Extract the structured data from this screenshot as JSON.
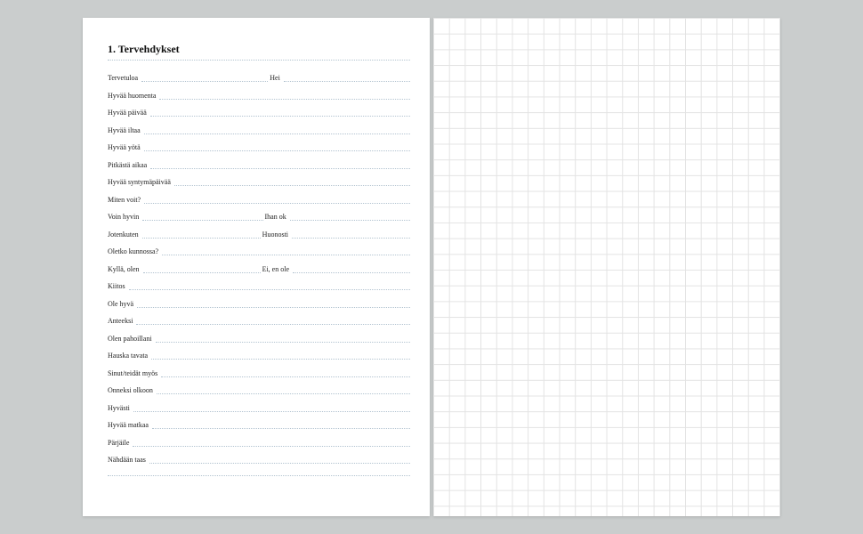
{
  "title": "1. Tervehdykset",
  "rows": [
    {
      "left": "Tervetuloa",
      "right": "Hei"
    },
    {
      "left": "Hyvää huomenta"
    },
    {
      "left": "Hyvää päivää"
    },
    {
      "left": "Hyvää iltaa"
    },
    {
      "left": "Hyvää yötä"
    },
    {
      "left": "Pitkästä aikaa"
    },
    {
      "left": "Hyvää syntymäpäivää"
    },
    {
      "left": "Miten voit?"
    },
    {
      "left": "Voin hyvin",
      "right": "Ihan ok"
    },
    {
      "left": "Jotenkuten",
      "right": "Huonosti"
    },
    {
      "left": "Oletko kunnossa?"
    },
    {
      "left": "Kyllä, olen",
      "right": "Ei, en ole"
    },
    {
      "left": "Kiitos"
    },
    {
      "left": "Ole hyvä"
    },
    {
      "left": "Anteeksi"
    },
    {
      "left": "Olen pahoillani"
    },
    {
      "left": "Hauska tavata"
    },
    {
      "left": "Sinut/teidät myös"
    },
    {
      "left": "Onneksi olkoon"
    },
    {
      "left": "Hyvästi"
    },
    {
      "left": "Hyvää matkaa"
    },
    {
      "left": "Pärjäile"
    },
    {
      "left": "Nähdään taas"
    }
  ]
}
